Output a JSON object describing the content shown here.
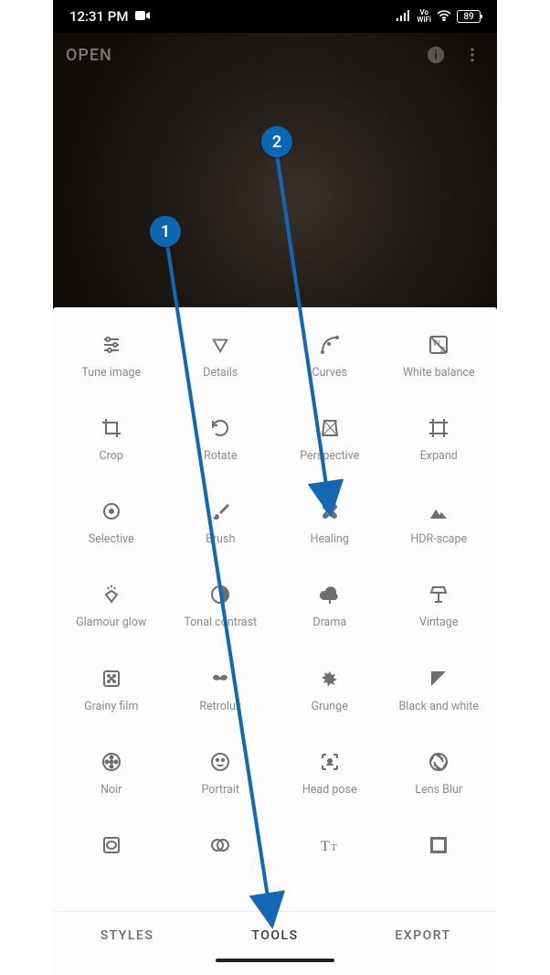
{
  "status_bar": {
    "time": "12:31 PM",
    "network_label": "Vo\nWiFi",
    "battery_pct": "89"
  },
  "appbar": {
    "open_label": "OPEN"
  },
  "tools": [
    {
      "id": "tune-image",
      "label": "Tune image"
    },
    {
      "id": "details",
      "label": "Details"
    },
    {
      "id": "curves",
      "label": "Curves"
    },
    {
      "id": "white-balance",
      "label": "White balance"
    },
    {
      "id": "crop",
      "label": "Crop"
    },
    {
      "id": "rotate",
      "label": "Rotate"
    },
    {
      "id": "perspective",
      "label": "Perspective"
    },
    {
      "id": "expand",
      "label": "Expand"
    },
    {
      "id": "selective",
      "label": "Selective"
    },
    {
      "id": "brush",
      "label": "Brush"
    },
    {
      "id": "healing",
      "label": "Healing"
    },
    {
      "id": "hdr-scape",
      "label": "HDR-scape"
    },
    {
      "id": "glamour-glow",
      "label": "Glamour glow"
    },
    {
      "id": "tonal-contrast",
      "label": "Tonal contrast"
    },
    {
      "id": "drama",
      "label": "Drama"
    },
    {
      "id": "vintage",
      "label": "Vintage"
    },
    {
      "id": "grainy-film",
      "label": "Grainy film"
    },
    {
      "id": "retrolux",
      "label": "Retrolux"
    },
    {
      "id": "grunge",
      "label": "Grunge"
    },
    {
      "id": "black-and-white",
      "label": "Black and white"
    },
    {
      "id": "noir",
      "label": "Noir"
    },
    {
      "id": "portrait",
      "label": "Portrait"
    },
    {
      "id": "head-pose",
      "label": "Head pose"
    },
    {
      "id": "lens-blur",
      "label": "Lens Blur"
    },
    {
      "id": "vignette",
      "label": ""
    },
    {
      "id": "double-exposure",
      "label": ""
    },
    {
      "id": "text",
      "label": ""
    },
    {
      "id": "frames",
      "label": ""
    }
  ],
  "bottom_tabs": {
    "styles": "STYLES",
    "tools": "TOOLS",
    "export": "EXPORT"
  },
  "annotations": {
    "badge1": "1",
    "badge2": "2"
  }
}
